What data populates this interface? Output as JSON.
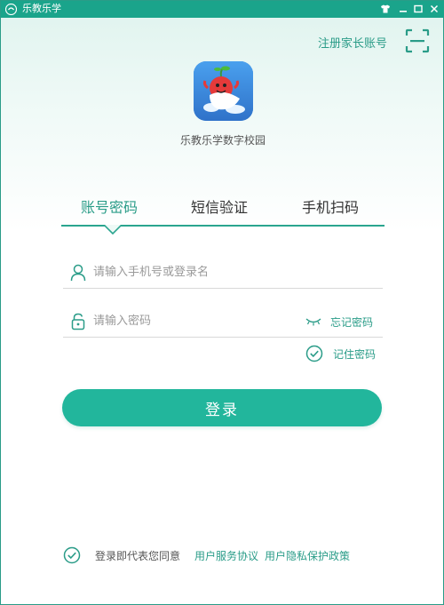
{
  "window": {
    "title": "乐教乐学",
    "buttons": [
      "skin-icon",
      "minimize-icon",
      "maximize-icon",
      "close-icon"
    ]
  },
  "header": {
    "register_label": "注册家长账号",
    "scan_icon": "scan-icon"
  },
  "brand": {
    "name": "乐教乐学数字校园"
  },
  "tabs": [
    {
      "label": "账号密码",
      "active": true
    },
    {
      "label": "短信验证",
      "active": false
    },
    {
      "label": "手机扫码",
      "active": false
    }
  ],
  "form": {
    "username_placeholder": "请输入手机号或登录名",
    "username_value": "",
    "password_placeholder": "请输入密码",
    "password_value": "",
    "forgot_label": "忘记密码",
    "remember_label": "记住密码",
    "remember_checked": true,
    "login_label": "登录"
  },
  "agreement": {
    "prefix": "登录即代表您同意",
    "terms_label": "用户服务协议",
    "privacy_label": "用户隐私保护政策",
    "checked": true
  },
  "colors": {
    "accent": "#2a9c88",
    "button": "#22b69c",
    "titlebar": "#1aa48b"
  }
}
